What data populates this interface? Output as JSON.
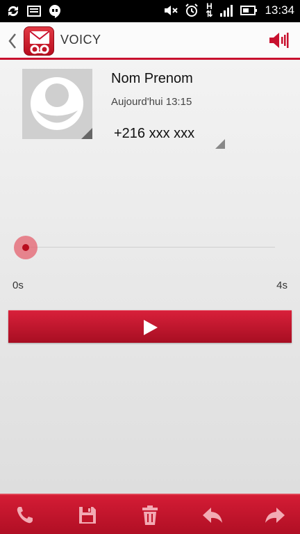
{
  "status_bar": {
    "time": "13:34",
    "network_type": "H"
  },
  "action_bar": {
    "title": "VOICY",
    "icons": [
      "back-arrow-icon",
      "voicy-logo-icon",
      "speaker-icon"
    ]
  },
  "contact": {
    "name": "Nom Prenom",
    "date": "Aujourd'hui 13:15",
    "phone": "+216 xxx xxx"
  },
  "player": {
    "start_label": "0s",
    "end_label": "4s",
    "progress": 0.0
  },
  "bottom_bar": {
    "icons": [
      "phone-icon",
      "save-icon",
      "delete-icon",
      "reply-icon",
      "forward-icon"
    ]
  },
  "colors": {
    "accent": "#c8102e",
    "bar_top": "#d41c35",
    "bar_bottom": "#b00f24"
  }
}
